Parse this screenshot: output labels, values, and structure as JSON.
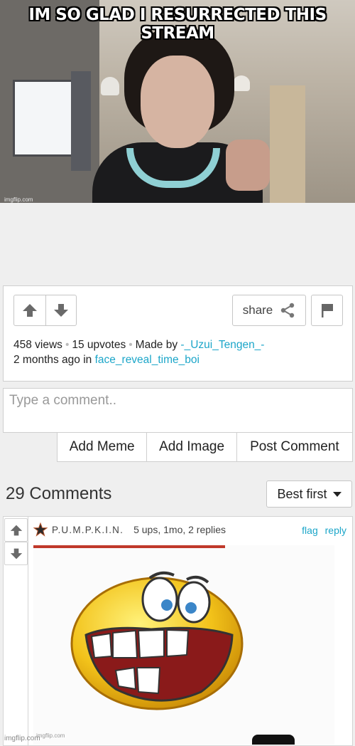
{
  "meme": {
    "caption": "IM SO GLAD I RESURRECTED THIS STREAM",
    "watermark": "imgflip.com"
  },
  "post": {
    "share_label": "share",
    "views": "458 views",
    "upvotes": "15 upvotes",
    "made_by_prefix": "Made by",
    "author": "-_Uzui_Tengen_-",
    "time_prefix": "2 months ago in",
    "stream": "face_reveal_time_boi"
  },
  "composer": {
    "placeholder": "Type a comment..",
    "add_meme": "Add Meme",
    "add_image": "Add Image",
    "post_comment": "Post Comment"
  },
  "comments": {
    "count_label": "29 Comments",
    "sort_label": "Best first",
    "items": [
      {
        "username": "P.U.M.P.K.I.N.",
        "meta": "5 ups, 1mo, 2 replies",
        "flag": "flag",
        "reply": "reply",
        "image_watermark": "imgflip.com"
      }
    ]
  },
  "footer_watermark": "imgflip.com",
  "colors": {
    "link": "#1ca6c9",
    "page_bg": "#efefef"
  }
}
